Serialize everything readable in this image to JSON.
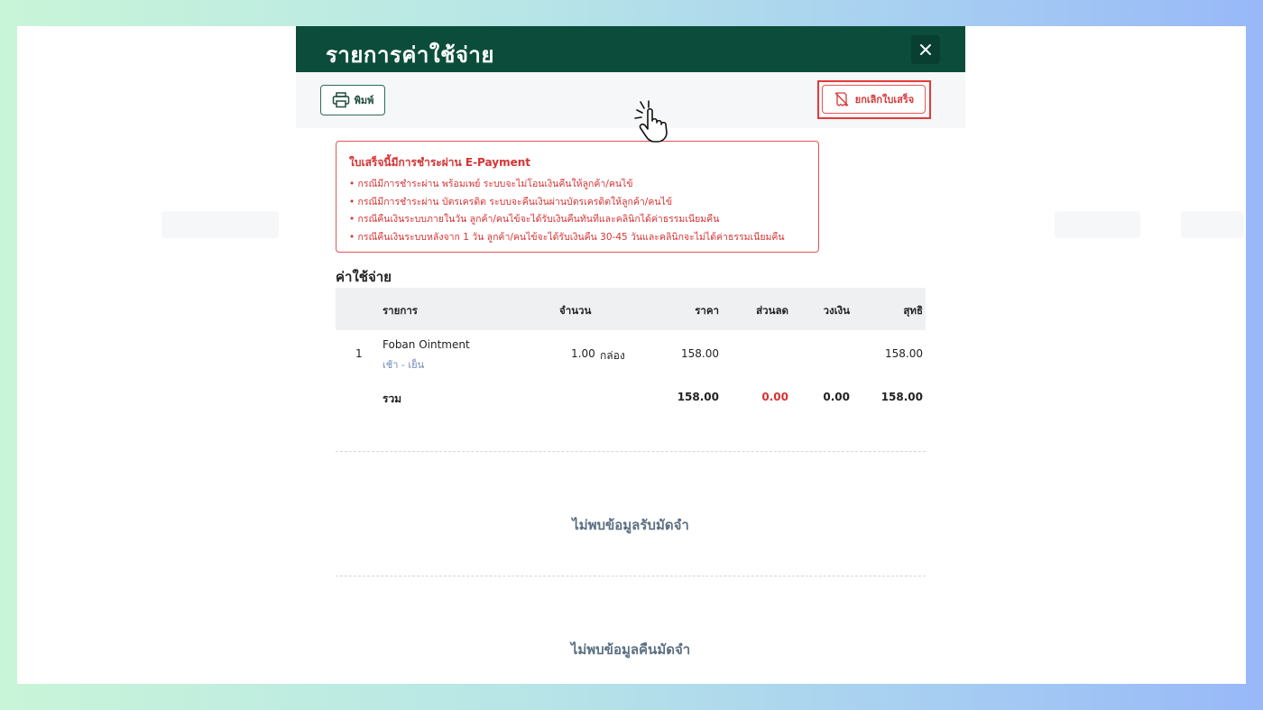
{
  "modal": {
    "title": "รายการค่าใช้จ่าย",
    "close_label": "✕"
  },
  "toolbar": {
    "print_label": "พิมพ์",
    "cancel_receipt_label": "ยกเลิกใบเสร็จ"
  },
  "warning": {
    "title": "ใบเสร็จนี้มีการชำระผ่าน E-Payment",
    "items": [
      "• กรณีมีการชำระผ่าน พร้อมเพย์ ระบบจะไม่โอนเงินคืนให้ลูกค้า/คนไข้",
      "• กรณีมีการชำระผ่าน บัตรเครดิต ระบบจะคืนเงินผ่านบัตรเครดิตให้ลูกค้า/คนไข้",
      "• กรณีคืนเงินระบบภายในวัน ลูกค้า/คนไข้จะได้รับเงินคืนทันทีและคลินิกได้ค่าธรรมเนียมคืน",
      "• กรณีคืนเงินระบบหลังจาก 1 วัน ลูกค้า/คนไข้จะได้รับเงินคืน 30-45 วันและคลินิกจะไม่ได้ค่าธรรมเนียมคืน"
    ]
  },
  "expenses": {
    "section_title": "ค่าใช้จ่าย",
    "headers": {
      "item": "รายการ",
      "qty": "จำนวน",
      "price": "ราคา",
      "discount": "ส่วนลด",
      "credit": "วงเงิน",
      "net": "สุทธิ"
    },
    "rows": [
      {
        "no": "1",
        "name": "Foban Ointment",
        "usage": "เช้า - เย็น",
        "qty": "1.00",
        "unit": "กล่อง",
        "price": "158.00",
        "discount": "",
        "credit": "",
        "net": "158.00"
      }
    ],
    "total": {
      "label": "รวม",
      "price": "158.00",
      "discount": "0.00",
      "credit": "0.00",
      "net": "158.00"
    }
  },
  "empty_states": {
    "deposit_received": "ไม่พบข้อมูลรับมัดจำ",
    "deposit_returned": "ไม่พบข้อมูลคืนมัดจำ"
  },
  "colors": {
    "header_bg": "#0b4d3a",
    "danger": "#d63333",
    "highlight": "#e33a3a"
  }
}
